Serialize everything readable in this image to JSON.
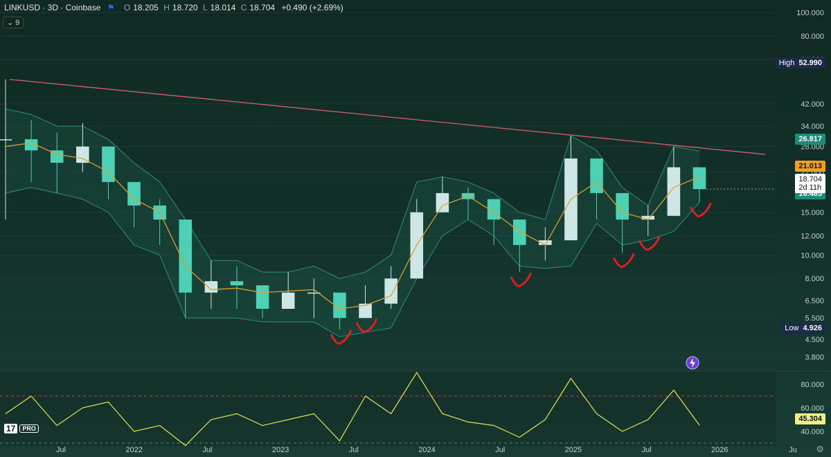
{
  "header": {
    "symbol_title": "LINKUSD · 3D · Coinbase",
    "open_label": "O",
    "open_value": "18.205",
    "high_label": "H",
    "high_value": "18.720",
    "low_label": "L",
    "low_value": "18.014",
    "close_label": "C",
    "close_value": "18.704",
    "change": "+0.490 (+2.69%)",
    "indicator_button": "9"
  },
  "badges": {
    "high_label": "High",
    "high_value": "52.990",
    "low_label": "Low",
    "low_value": "4.926",
    "upper_band": "26.817",
    "ma_value": "21.013",
    "last_price": "18.704",
    "countdown": "2d 11h",
    "lower_band": "16.485",
    "rsi_value": "45.304"
  },
  "colors": {
    "up": "#cfe6e6",
    "down": "#4dd0b3",
    "ma": "#d9a12a",
    "band": "#2d8f74",
    "trendline": "#e05c6b",
    "annotation": "#e01e1e",
    "rsi": "#e6e64a",
    "upper_badge": "#1e8a78",
    "ma_badge": "#f0a020",
    "lower_badge": "#1e8a78"
  },
  "icons": {
    "logo": "tradingview-logo",
    "settings": "gear-icon",
    "alert": "alert-icon",
    "flag": "flag-icon",
    "symbol": "chainlink-icon"
  },
  "tv_logo": {
    "mark": "17",
    "pro": "PRO"
  },
  "chart_data": [
    {
      "type": "candlestick",
      "title": "LINKUSD · 3D · Coinbase",
      "y_scale": "log",
      "ylim": [
        3.5,
        100
      ],
      "y_ticks": [
        "100.000",
        "80.000",
        "64.000",
        "42.000",
        "34.000",
        "28.000",
        "22.000",
        "15.000",
        "12.000",
        "10.000",
        "8.000",
        "6.500",
        "5.500",
        "4.500",
        "3.800"
      ],
      "x_ticks": [
        "Jul",
        "2022",
        "Jul",
        "2023",
        "Jul",
        "2024",
        "Jul",
        "2025",
        "Jul",
        "2026",
        "Ju"
      ],
      "x": [
        "2021-04",
        "2021-06",
        "2021-08",
        "2021-10",
        "2021-12",
        "2022-02",
        "2022-04",
        "2022-06",
        "2022-08",
        "2022-10",
        "2022-12",
        "2023-02",
        "2023-04",
        "2023-06",
        "2023-08",
        "2023-10",
        "2023-12",
        "2024-02",
        "2024-04",
        "2024-06",
        "2024-08",
        "2024-10",
        "2024-12",
        "2025-02",
        "2025-04",
        "2025-06",
        "2025-08",
        "2025-10"
      ],
      "close": [
        30.0,
        27.0,
        24.0,
        28.0,
        20.0,
        16.0,
        14.0,
        7.0,
        7.8,
        7.5,
        6.0,
        7.0,
        7.0,
        5.5,
        6.3,
        8.0,
        15.0,
        18.0,
        17.0,
        14.0,
        11.0,
        11.5,
        25.0,
        18.0,
        14.0,
        14.5,
        23.0,
        18.7
      ],
      "high": [
        52.99,
        36.0,
        32.0,
        35.0,
        25.0,
        19.0,
        17.0,
        9.0,
        9.5,
        9.0,
        7.5,
        8.5,
        8.0,
        6.5,
        7.5,
        9.0,
        17.0,
        21.0,
        19.0,
        16.0,
        12.5,
        13.0,
        31.0,
        22.0,
        16.0,
        16.0,
        28.0,
        20.0
      ],
      "low": [
        14.0,
        20.0,
        18.0,
        22.0,
        17.0,
        13.0,
        11.0,
        5.5,
        6.0,
        6.0,
        5.5,
        6.0,
        5.5,
        4.926,
        5.5,
        6.0,
        12.0,
        15.0,
        14.0,
        11.0,
        8.5,
        9.5,
        18.0,
        14.0,
        10.2,
        12.0,
        18.0,
        16.5
      ],
      "ma": [
        28.0,
        29.0,
        26.0,
        25.0,
        22.0,
        17.0,
        15.0,
        9.0,
        7.2,
        7.3,
        7.0,
        7.1,
        7.2,
        6.0,
        6.2,
        6.8,
        11.0,
        16.0,
        17.5,
        15.0,
        12.5,
        11.0,
        17.0,
        20.0,
        15.0,
        14.0,
        19.0,
        21.013
      ],
      "band_upper": [
        40.0,
        38.0,
        34.0,
        34.0,
        30.0,
        24.0,
        20.0,
        14.0,
        9.5,
        9.5,
        8.5,
        8.5,
        9.0,
        8.0,
        8.5,
        10.0,
        20.0,
        21.0,
        20.0,
        18.0,
        15.0,
        14.0,
        31.0,
        27.0,
        19.0,
        16.0,
        28.0,
        26.817
      ],
      "band_lower": [
        18.0,
        19.0,
        18.0,
        17.0,
        15.0,
        11.0,
        10.0,
        5.5,
        5.5,
        5.5,
        5.3,
        5.3,
        5.3,
        4.6,
        4.8,
        5.0,
        8.0,
        12.0,
        14.0,
        12.0,
        9.0,
        8.8,
        9.0,
        13.5,
        11.0,
        11.5,
        12.5,
        16.485
      ],
      "last_price": 18.704,
      "high_marker": 52.99,
      "low_marker": 4.926,
      "trendline_start": 52.99,
      "trendline_end": 26.0
    },
    {
      "type": "line",
      "ylim": [
        30,
        90
      ],
      "y_ticks": [
        "80.000",
        "60.000",
        "40.000"
      ],
      "overbought_level": 70,
      "oversold_level": 30,
      "values": [
        55,
        70,
        45,
        60,
        65,
        40,
        45,
        28,
        50,
        55,
        45,
        50,
        55,
        32,
        70,
        55,
        90,
        55,
        48,
        45,
        35,
        50,
        85,
        55,
        40,
        50,
        75,
        45.304
      ],
      "last_value": 45.304
    }
  ]
}
